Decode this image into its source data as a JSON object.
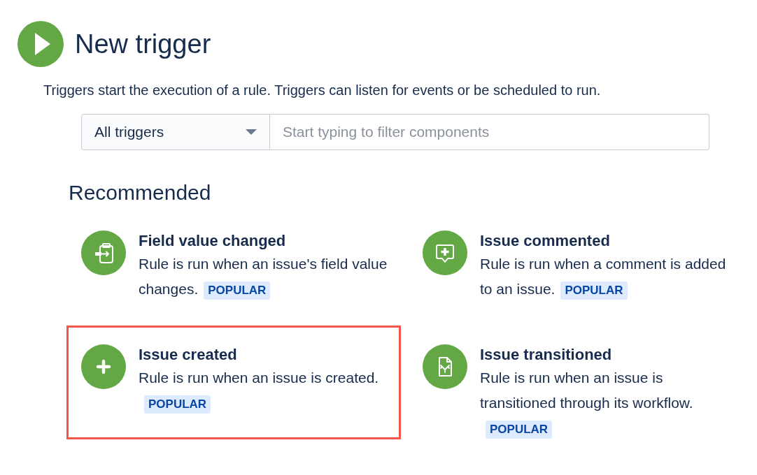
{
  "header": {
    "title": "New trigger",
    "description": "Triggers start the execution of a rule. Triggers can listen for events or be scheduled to run."
  },
  "filter": {
    "select": "All triggers",
    "placeholder": "Start typing to filter components"
  },
  "section": {
    "title": "Recommended"
  },
  "cards": [
    {
      "kind": "field",
      "title": "Field value changed",
      "description": "Rule is run when an issue's field value changes.",
      "badge": "POPULAR",
      "highlighted": false
    },
    {
      "kind": "comment",
      "title": "Issue commented",
      "description": "Rule is run when a comment is added to an issue.",
      "badge": "POPULAR",
      "highlighted": false
    },
    {
      "kind": "create",
      "title": "Issue created",
      "description": "Rule is run when an issue is created.",
      "badge": "POPULAR",
      "highlighted": true
    },
    {
      "kind": "transition",
      "title": "Issue transitioned",
      "description": "Rule is run when an issue is transitioned through its workflow.",
      "badge": "POPULAR",
      "highlighted": false
    }
  ]
}
